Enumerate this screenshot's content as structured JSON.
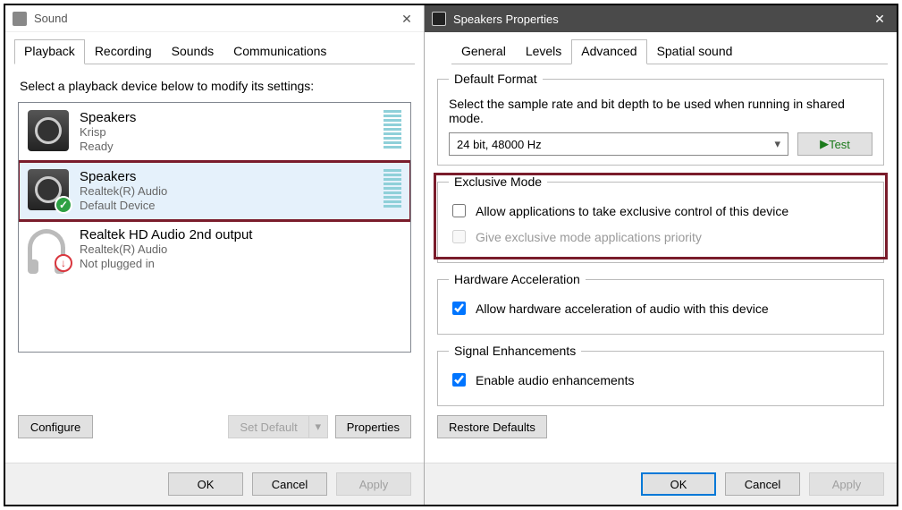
{
  "sound_dialog": {
    "title": "Sound",
    "tabs": [
      "Playback",
      "Recording",
      "Sounds",
      "Communications"
    ],
    "selected_tab": 0,
    "instruction": "Select a playback device below to modify its settings:",
    "devices": [
      {
        "name": "Speakers",
        "driver": "Krisp",
        "status": "Ready",
        "icon": "speaker",
        "badge": null,
        "meter": true
      },
      {
        "name": "Speakers",
        "driver": "Realtek(R) Audio",
        "status": "Default Device",
        "icon": "speaker",
        "badge": "check",
        "meter": true,
        "selected": true,
        "highlight": true
      },
      {
        "name": "Realtek HD Audio 2nd output",
        "driver": "Realtek(R) Audio",
        "status": "Not plugged in",
        "icon": "headphone",
        "badge": "down",
        "meter": false
      }
    ],
    "buttons": {
      "configure": "Configure",
      "set_default": "Set Default",
      "properties": "Properties",
      "ok": "OK",
      "cancel": "Cancel",
      "apply": "Apply"
    }
  },
  "props_dialog": {
    "title": "Speakers Properties",
    "tabs": [
      "General",
      "Levels",
      "Advanced",
      "Spatial sound"
    ],
    "selected_tab": 2,
    "default_format": {
      "legend": "Default Format",
      "desc": "Select the sample rate and bit depth to be used when running in shared mode.",
      "value": "24 bit, 48000 Hz",
      "test": "Test"
    },
    "exclusive": {
      "legend": "Exclusive Mode",
      "opt1": "Allow applications to take exclusive control of this device",
      "opt1_checked": false,
      "opt2": "Give exclusive mode applications priority",
      "opt2_checked": false,
      "opt2_disabled": true,
      "highlight": true
    },
    "hwaccel": {
      "legend": "Hardware Acceleration",
      "opt": "Allow hardware acceleration of audio with this device",
      "checked": true
    },
    "signal": {
      "legend": "Signal Enhancements",
      "opt": "Enable audio enhancements",
      "checked": true
    },
    "restore": "Restore Defaults",
    "buttons": {
      "ok": "OK",
      "cancel": "Cancel",
      "apply": "Apply"
    }
  }
}
